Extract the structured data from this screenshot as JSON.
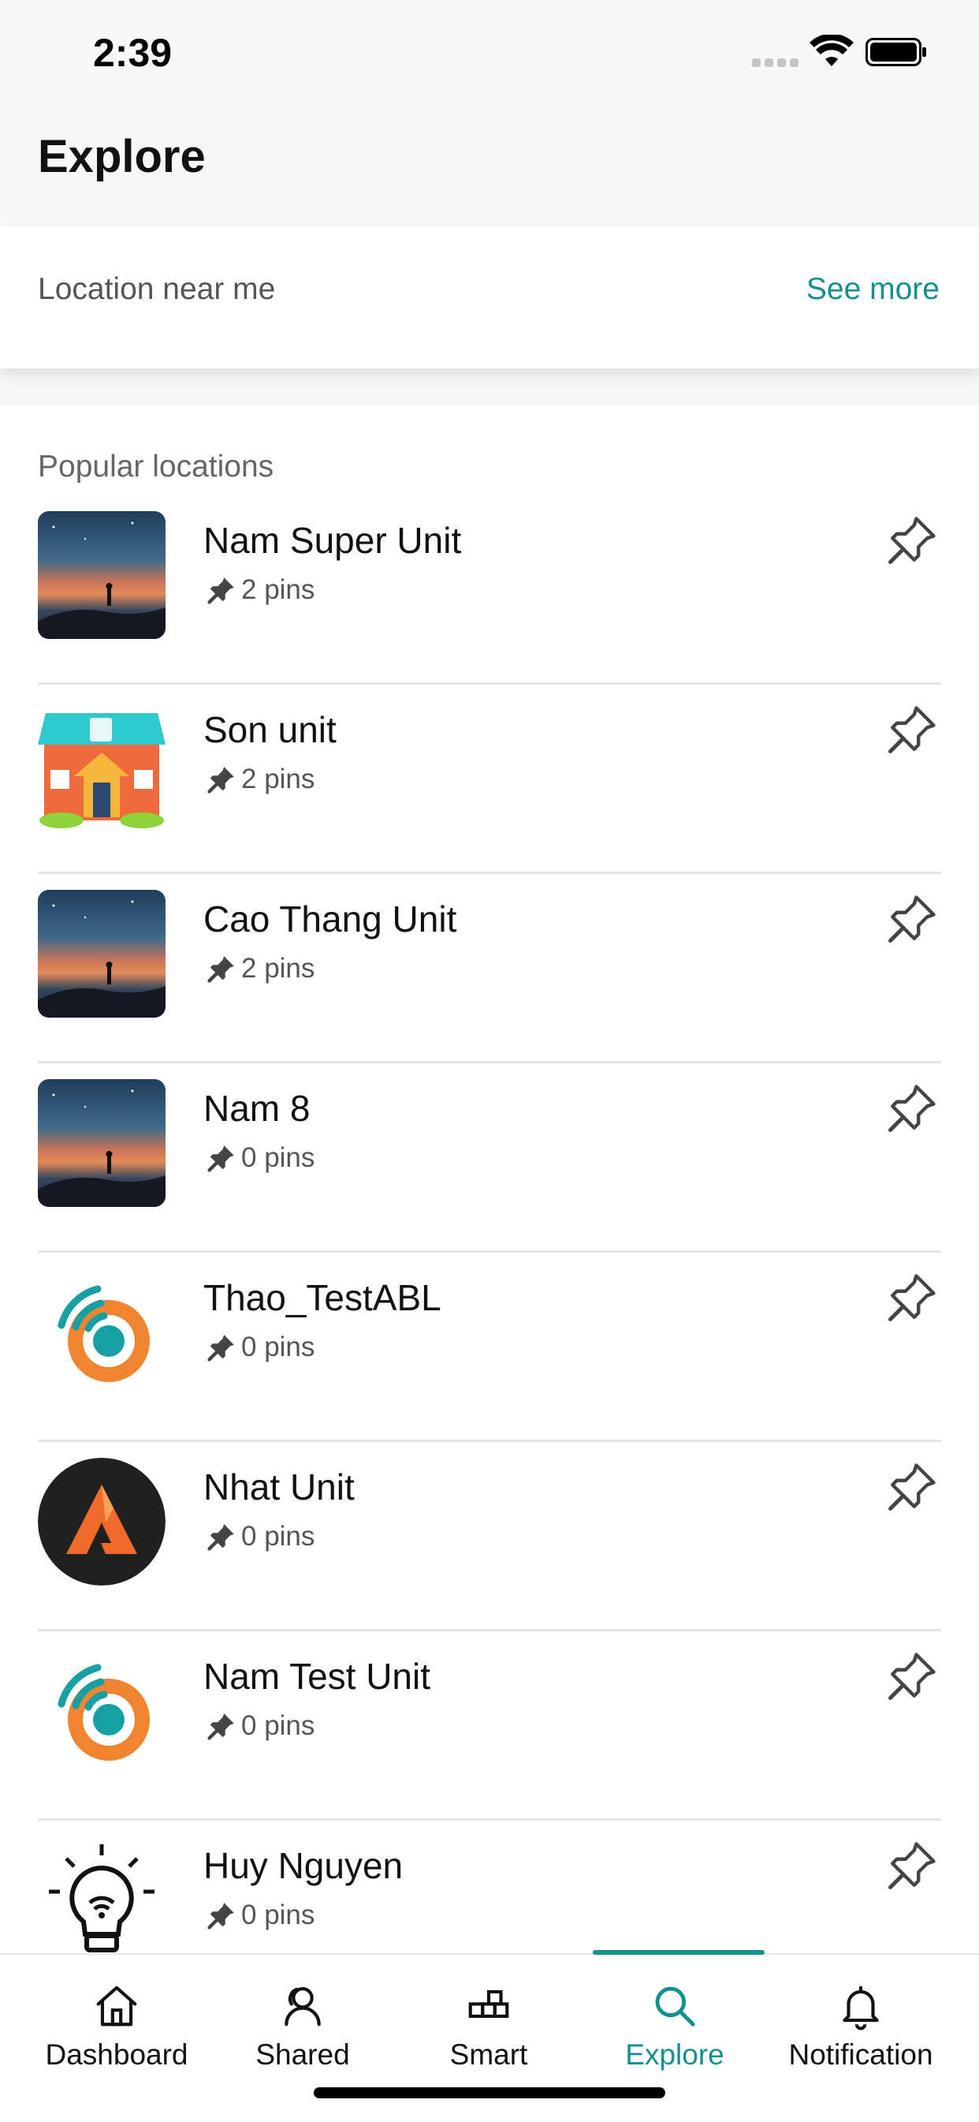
{
  "status_bar": {
    "time": "2:39"
  },
  "header": {
    "title": "Explore"
  },
  "near_me": {
    "label": "Location near me",
    "see_more": "See more"
  },
  "popular": {
    "title": "Popular locations",
    "items": [
      {
        "name": "Nam Super Unit",
        "pins": "2 pins",
        "image": "night-sky-photo"
      },
      {
        "name": "Son unit",
        "pins": "2 pins",
        "image": "house-icon"
      },
      {
        "name": "Cao Thang Unit",
        "pins": "2 pins",
        "image": "night-sky-photo"
      },
      {
        "name": "Nam 8",
        "pins": "0 pins",
        "image": "night-sky-photo"
      },
      {
        "name": "Thao_TestABL",
        "pins": "0 pins",
        "image": "signal-logo"
      },
      {
        "name": "Nhat Unit",
        "pins": "0 pins",
        "image": "a-logo"
      },
      {
        "name": "Nam Test Unit",
        "pins": "0 pins",
        "image": "signal-logo"
      },
      {
        "name": "Huy Nguyen",
        "pins": "0 pins",
        "image": "lightbulb-icon"
      }
    ]
  },
  "tabs": [
    {
      "label": "Dashboard",
      "icon": "home-icon"
    },
    {
      "label": "Shared",
      "icon": "shared-user-icon"
    },
    {
      "label": "Smart",
      "icon": "smart-blocks-icon"
    },
    {
      "label": "Explore",
      "icon": "search-icon",
      "active": true
    },
    {
      "label": "Notification",
      "icon": "bell-icon"
    }
  ],
  "colors": {
    "accent": "#13918f",
    "header_bg": "#f8f8f8",
    "text": "#111111",
    "muted": "#555555"
  }
}
